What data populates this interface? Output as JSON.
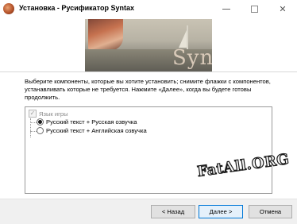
{
  "window": {
    "title": "Установка - Русификатор Syntax",
    "minimize_icon": "minimize-icon",
    "maximize_icon": "maximize-icon",
    "close_icon": "close-icon",
    "close_glyph": "✕"
  },
  "banner": {
    "logo_text": "Syntax"
  },
  "instructions": "Выберите компоненты, которые вы хотите установить; снимите флажки с компонентов, устанавливать которые не требуется. Нажмите «Далее», когда вы будете готовы продолжить.",
  "components": {
    "group": {
      "label": "Язык игры",
      "checked": true,
      "disabled": true
    },
    "options": [
      {
        "label": "Русский текст + Русская озвучка",
        "selected": true
      },
      {
        "label": "Русский текст + Английская озвучка",
        "selected": false
      }
    ]
  },
  "watermark": "FatAll.ORG",
  "buttons": {
    "back": "< Назад",
    "next": "Далее >",
    "cancel": "Отмена"
  }
}
